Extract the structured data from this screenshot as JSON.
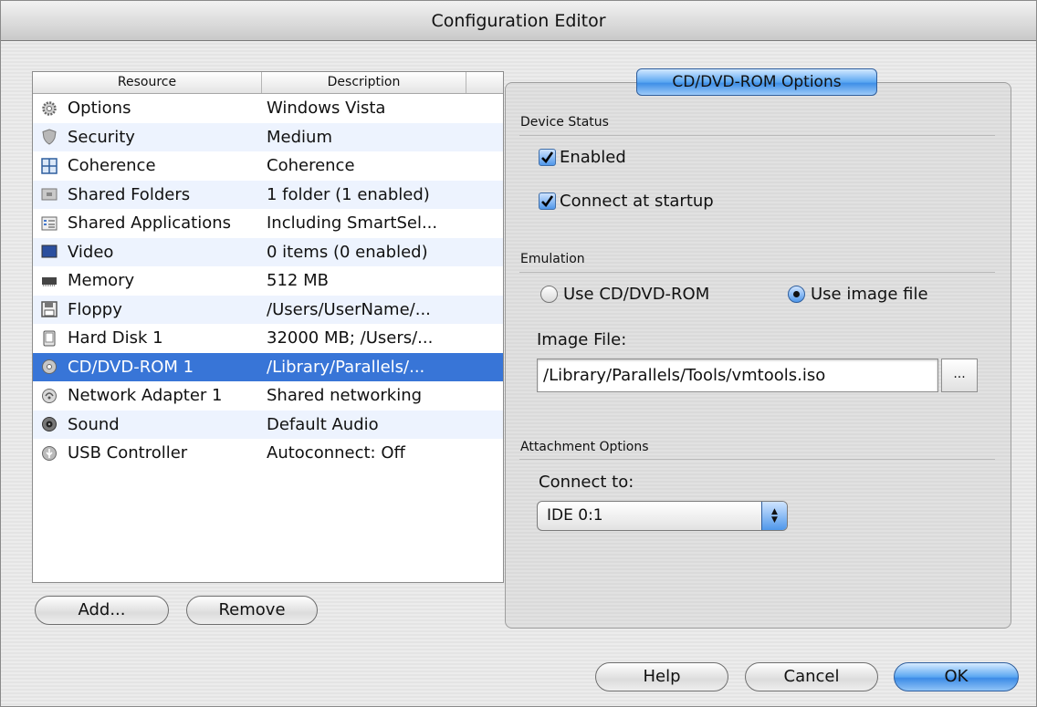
{
  "window": {
    "title": "Configuration Editor"
  },
  "resources": {
    "columns": [
      "Resource",
      "Description"
    ],
    "rows": [
      {
        "name": "Options",
        "desc": "Windows Vista",
        "icon": "gear-icon"
      },
      {
        "name": "Security",
        "desc": "Medium",
        "icon": "shield-icon"
      },
      {
        "name": "Coherence",
        "desc": "Coherence",
        "icon": "coherence-icon"
      },
      {
        "name": "Shared Folders",
        "desc": "1 folder (1 enabled)",
        "icon": "folder-icon"
      },
      {
        "name": "Shared Applications",
        "desc": "Including SmartSel...",
        "icon": "applications-icon"
      },
      {
        "name": "Video",
        "desc": "0 items (0 enabled)",
        "icon": "monitor-icon"
      },
      {
        "name": "Memory",
        "desc": "512 MB",
        "icon": "memory-chip-icon"
      },
      {
        "name": "Floppy",
        "desc": "/Users/UserName/...",
        "icon": "floppy-icon"
      },
      {
        "name": "Hard Disk 1",
        "desc": "32000 MB; /Users/...",
        "icon": "hard-disk-icon"
      },
      {
        "name": "CD/DVD-ROM 1",
        "desc": "/Library/Parallels/...",
        "icon": "disc-icon",
        "selected": true
      },
      {
        "name": "Network Adapter 1",
        "desc": "Shared networking",
        "icon": "network-icon"
      },
      {
        "name": "Sound",
        "desc": "Default Audio",
        "icon": "speaker-icon"
      },
      {
        "name": "USB Controller",
        "desc": "Autoconnect: Off",
        "icon": "usb-icon"
      }
    ]
  },
  "list_buttons": {
    "add": "Add...",
    "remove": "Remove"
  },
  "panel": {
    "title": "CD/DVD-ROM Options",
    "device_status": {
      "label": "Device Status",
      "enabled": {
        "label": "Enabled",
        "checked": true
      },
      "connect_at_startup": {
        "label": "Connect at startup",
        "checked": true
      }
    },
    "emulation": {
      "label": "Emulation",
      "use_cd": {
        "label": "Use CD/DVD-ROM",
        "selected": false
      },
      "use_image": {
        "label": "Use image file",
        "selected": true
      },
      "image_file_label": "Image File:",
      "image_file_value": "/Library/Parallels/Tools/vmtools.iso",
      "browse_label": "..."
    },
    "attachment": {
      "label": "Attachment Options",
      "connect_to_label": "Connect to:",
      "connect_to_value": "IDE 0:1"
    }
  },
  "dialog_buttons": {
    "help": "Help",
    "cancel": "Cancel",
    "ok": "OK"
  },
  "colors": {
    "selection": "#3875d7",
    "alt_row": "#edf3fe",
    "aqua_blue": "#4f97ea"
  }
}
